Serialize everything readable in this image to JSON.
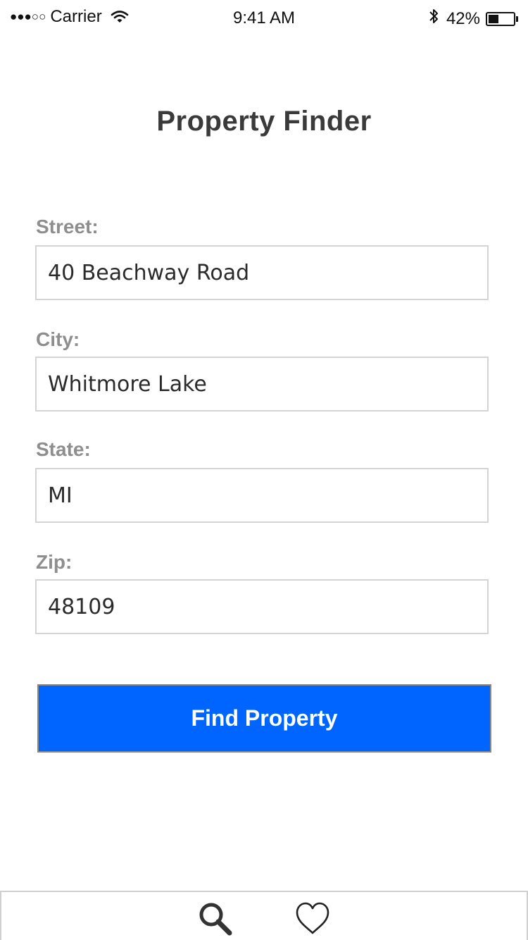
{
  "status_bar": {
    "signal": "●●●○○",
    "carrier": "Carrier",
    "time": "9:41 AM",
    "battery_percent": "42%",
    "battery_level": 0.42,
    "icons": [
      "wifi-icon",
      "bluetooth-icon",
      "battery-icon"
    ]
  },
  "title": "Property Finder",
  "form": {
    "street": {
      "label": "Street:",
      "value": "40 Beachway Road"
    },
    "city": {
      "label": "City:",
      "value": "Whitmore Lake"
    },
    "state": {
      "label": "State:",
      "value": "MI"
    },
    "zip": {
      "label": "Zip:",
      "value": "48109"
    }
  },
  "button": {
    "label": "Find Property",
    "color": "#0064ff"
  },
  "tab_bar": {
    "tabs": [
      {
        "icon": "search-icon"
      },
      {
        "icon": "heart-icon"
      }
    ]
  }
}
